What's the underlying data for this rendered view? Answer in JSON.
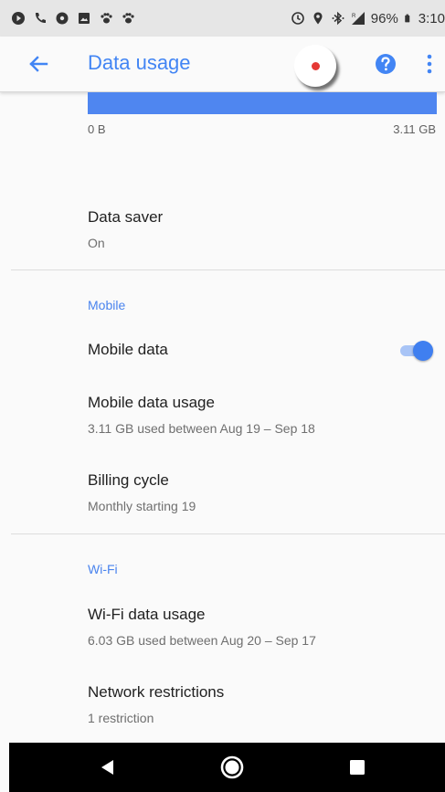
{
  "status_bar": {
    "battery_percent": "96%",
    "time": "3:10",
    "icons_left": [
      "play-icon",
      "phone-icon",
      "media-icon",
      "image-icon",
      "paw-icon",
      "paw-icon"
    ],
    "icons_right": [
      "sync-icon",
      "location-icon",
      "bluetooth-icon",
      "signal-icon",
      "battery-icon"
    ]
  },
  "app_bar": {
    "title": "Data usage",
    "back_icon": "arrow-back-icon",
    "help_icon": "help-icon",
    "more_icon": "more-vert-icon",
    "accent_color": "#4285f4"
  },
  "usage_graph": {
    "min_label": "0 B",
    "max_label": "3.11 GB",
    "bar_color": "#4f86f0"
  },
  "data_saver": {
    "title": "Data saver",
    "value": "On"
  },
  "mobile_section": {
    "header": "Mobile",
    "mobile_data": {
      "title": "Mobile data",
      "enabled": true
    },
    "mobile_data_usage": {
      "title": "Mobile data usage",
      "subtitle": "3.11 GB used between Aug 19 – Sep 18"
    },
    "billing_cycle": {
      "title": "Billing cycle",
      "subtitle": "Monthly starting 19"
    }
  },
  "wifi_section": {
    "header": "Wi-Fi",
    "wifi_data_usage": {
      "title": "Wi-Fi data usage",
      "subtitle": "6.03 GB used between Aug 20 – Sep 17"
    },
    "network_restrictions": {
      "title": "Network restrictions",
      "subtitle": "1 restriction"
    }
  },
  "nav_bar": {
    "back": "nav-back-icon",
    "home": "nav-home-icon",
    "recents": "nav-recents-icon"
  }
}
